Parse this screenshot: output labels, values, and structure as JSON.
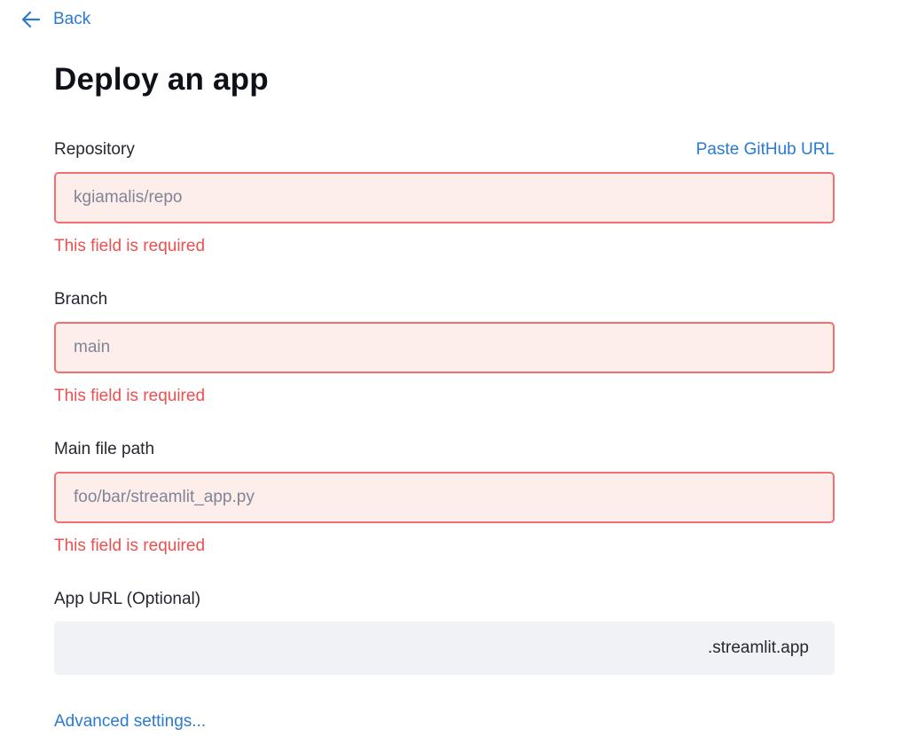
{
  "nav": {
    "back_label": "Back"
  },
  "page": {
    "title": "Deploy an app"
  },
  "form": {
    "repository": {
      "label": "Repository",
      "link_label": "Paste GitHub URL",
      "placeholder": "kgiamalis/repo",
      "value": "",
      "error": "This field is required"
    },
    "branch": {
      "label": "Branch",
      "placeholder": "main",
      "value": "",
      "error": "This field is required"
    },
    "main_file": {
      "label": "Main file path",
      "placeholder": "foo/bar/streamlit_app.py",
      "value": "",
      "error": "This field is required"
    },
    "app_url": {
      "label": "App URL (Optional)",
      "value": "",
      "suffix": ".streamlit.app"
    }
  },
  "footer": {
    "advanced_label": "Advanced settings..."
  },
  "colors": {
    "link": "#2a7ad1",
    "error": "#ee4f4f",
    "error_border": "#f06f6f",
    "error_fill": "#fdeeec",
    "neutral_fill": "#f0f2f6"
  },
  "icons": {
    "back": "arrow-left-icon"
  }
}
